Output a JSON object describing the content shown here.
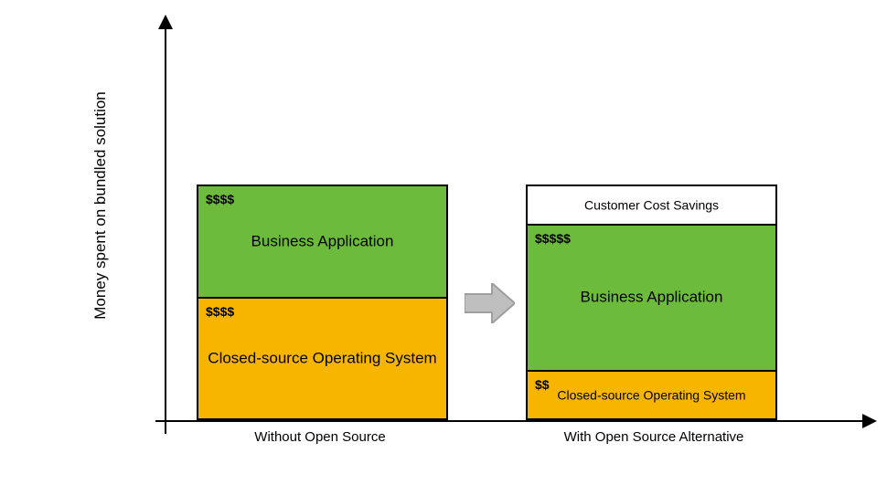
{
  "chart_data": {
    "type": "bar",
    "title": "",
    "ylabel": "Money spent on bundled solution",
    "xlabel": "",
    "categories": [
      "Without Open Source",
      "With Open Source Alternative"
    ],
    "ylim": [
      0,
      260
    ],
    "series_note": "values are stacked segment heights in px as read from the figure; cost_label is the $$ annotation shown inside each segment",
    "stacks": [
      {
        "category": "Without Open Source",
        "segments": [
          {
            "name": "Closed-source Operating System",
            "value": 135,
            "cost_label": "$$$$",
            "color": "#f7b500"
          },
          {
            "name": "Business Application",
            "value": 123,
            "cost_label": "$$$$",
            "color": "#6cbb3c"
          }
        ]
      },
      {
        "category": "With Open Source Alternative",
        "segments": [
          {
            "name": "Closed-source Operating System",
            "value": 55,
            "cost_label": "$$",
            "color": "#f7b500"
          },
          {
            "name": "Business Application",
            "value": 160,
            "cost_label": "$$$$$",
            "color": "#6cbb3c"
          },
          {
            "name": "Customer Cost Savings",
            "value": 43,
            "cost_label": "",
            "color": "#ffffff"
          }
        ]
      }
    ]
  }
}
